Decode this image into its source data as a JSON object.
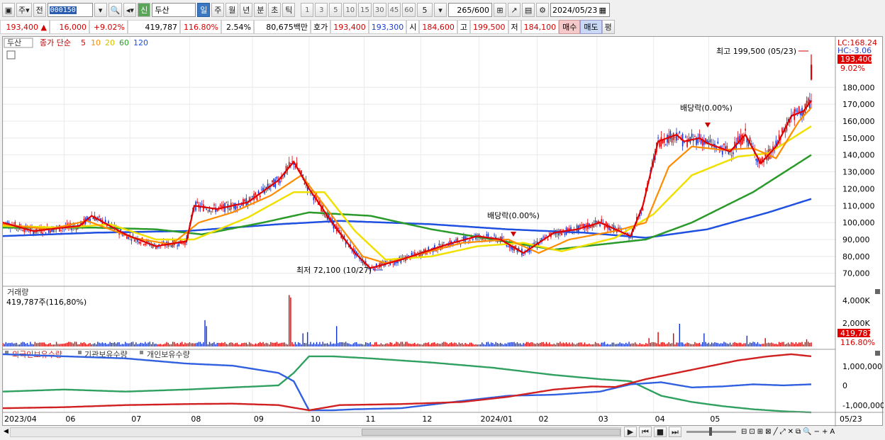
{
  "toolbar": {
    "market_label": "주",
    "prev_label": "전",
    "code": "000150",
    "name_badge": "신",
    "name": "두산",
    "periods": [
      "일",
      "주",
      "월",
      "년",
      "분",
      "초",
      "틱"
    ],
    "minute_steps": [
      "1",
      "3",
      "5",
      "10",
      "15",
      "30",
      "45",
      "60"
    ],
    "step_value": "5",
    "count": "265/600",
    "date": "2024/05/23"
  },
  "infobar": {
    "price": "193,400",
    "change": "16,000",
    "change_pct": "+9.02%",
    "volume": "419,787",
    "volume_ratio": "116.80%",
    "turnover": "2.54%",
    "amount": "80,675백만",
    "quote_label": "호가",
    "ask": "193,400",
    "bid": "193,300",
    "open_label": "시",
    "open": "184,600",
    "high_label": "고",
    "high": "199,500",
    "low_label": "저",
    "low": "184,100",
    "buy": "매수",
    "sell": "매도",
    "eval": "평"
  },
  "chart_data": {
    "type": "line",
    "title": "두산",
    "legend": {
      "stock_name": "두산",
      "ma_prefix": "종가 단순",
      "ma_periods": [
        "5",
        "10",
        "20",
        "60",
        "120"
      ]
    },
    "colors": {
      "ma5": "#e00000",
      "ma10": "#ff8c00",
      "ma20": "#f0e000",
      "ma60": "#2a9a2a",
      "ma120": "#2050e0",
      "up": "#e00000",
      "down": "#1030d0",
      "foreign": "#d02020",
      "inst": "#3060e0",
      "indiv": "#30a060"
    },
    "price_axis": {
      "ticks": [
        70000,
        80000,
        90000,
        100000,
        110000,
        120000,
        130000,
        140000,
        150000,
        160000,
        170000,
        180000
      ],
      "tick_labels": [
        "70,000",
        "80,000",
        "90,000",
        "100,000",
        "110,000",
        "120,000",
        "130,000",
        "140,000",
        "150,000",
        "160,000",
        "170,000",
        "180,000"
      ],
      "range": [
        64000,
        204000
      ]
    },
    "upper_labels": {
      "lc": "LC:168.24",
      "hc": "HC:-3.06",
      "price": "193,400",
      "pct": "9.02%"
    },
    "annotations": {
      "high": "최고 199,500 (05/23)",
      "low": "최저 72,100 (10/27)",
      "div1": "배당락(0.00%)",
      "div2": "배당락(0.00%)"
    },
    "x_axis": {
      "labels": [
        "2023/04",
        "06",
        "07",
        "08",
        "09",
        "10",
        "11",
        "12",
        "2024/01",
        "02",
        "03",
        "04",
        "05",
        "05/23"
      ],
      "label_index": [
        0,
        40,
        83,
        122,
        163,
        200,
        236,
        273,
        311,
        349,
        388,
        425,
        461,
        520
      ]
    },
    "ma_nodes": {
      "ma5": [
        [
          0,
          100000
        ],
        [
          20,
          95000
        ],
        [
          50,
          98000
        ],
        [
          58,
          104000
        ],
        [
          80,
          93000
        ],
        [
          100,
          86000
        ],
        [
          120,
          89000
        ],
        [
          125,
          110000
        ],
        [
          140,
          108000
        ],
        [
          160,
          112000
        ],
        [
          180,
          125000
        ],
        [
          190,
          136000
        ],
        [
          200,
          120000
        ],
        [
          215,
          100000
        ],
        [
          230,
          82000
        ],
        [
          240,
          73000
        ],
        [
          260,
          78000
        ],
        [
          290,
          87000
        ],
        [
          310,
          92000
        ],
        [
          325,
          90000
        ],
        [
          340,
          82000
        ],
        [
          360,
          94000
        ],
        [
          375,
          96000
        ],
        [
          390,
          100000
        ],
        [
          410,
          92000
        ],
        [
          418,
          110000
        ],
        [
          428,
          148000
        ],
        [
          440,
          152000
        ],
        [
          445,
          148000
        ],
        [
          455,
          150000
        ],
        [
          460,
          147000
        ],
        [
          475,
          142000
        ],
        [
          485,
          152000
        ],
        [
          495,
          135000
        ],
        [
          505,
          145000
        ],
        [
          515,
          163000
        ],
        [
          523,
          166000
        ],
        [
          528,
          172000
        ]
      ],
      "ma10": [
        [
          0,
          99000
        ],
        [
          30,
          96000
        ],
        [
          55,
          101000
        ],
        [
          85,
          91000
        ],
        [
          110,
          87000
        ],
        [
          128,
          100000
        ],
        [
          150,
          106000
        ],
        [
          175,
          116000
        ],
        [
          195,
          128000
        ],
        [
          210,
          110000
        ],
        [
          235,
          80000
        ],
        [
          250,
          76000
        ],
        [
          275,
          82000
        ],
        [
          300,
          88000
        ],
        [
          330,
          90000
        ],
        [
          350,
          82000
        ],
        [
          370,
          90000
        ],
        [
          400,
          95000
        ],
        [
          420,
          100000
        ],
        [
          435,
          133000
        ],
        [
          450,
          145000
        ],
        [
          470,
          143000
        ],
        [
          490,
          144000
        ],
        [
          505,
          138000
        ],
        [
          520,
          160000
        ],
        [
          528,
          168000
        ]
      ],
      "ma20": [
        [
          0,
          98000
        ],
        [
          40,
          97000
        ],
        [
          70,
          99000
        ],
        [
          100,
          90000
        ],
        [
          125,
          90000
        ],
        [
          160,
          103000
        ],
        [
          190,
          118000
        ],
        [
          210,
          118000
        ],
        [
          230,
          95000
        ],
        [
          250,
          78000
        ],
        [
          280,
          80000
        ],
        [
          310,
          86000
        ],
        [
          340,
          88000
        ],
        [
          365,
          83000
        ],
        [
          400,
          91000
        ],
        [
          425,
          105000
        ],
        [
          450,
          128000
        ],
        [
          480,
          139000
        ],
        [
          500,
          141000
        ],
        [
          528,
          157000
        ]
      ],
      "ma60": [
        [
          0,
          97000
        ],
        [
          60,
          97000
        ],
        [
          100,
          96000
        ],
        [
          130,
          93000
        ],
        [
          170,
          100000
        ],
        [
          200,
          106000
        ],
        [
          240,
          104000
        ],
        [
          280,
          96000
        ],
        [
          320,
          90000
        ],
        [
          360,
          84000
        ],
        [
          400,
          88000
        ],
        [
          420,
          90000
        ],
        [
          450,
          100000
        ],
        [
          490,
          118000
        ],
        [
          528,
          140000
        ]
      ],
      "ma120": [
        [
          0,
          92000
        ],
        [
          60,
          94000
        ],
        [
          120,
          95000
        ],
        [
          180,
          99000
        ],
        [
          220,
          101000
        ],
        [
          280,
          99000
        ],
        [
          330,
          96000
        ],
        [
          380,
          94000
        ],
        [
          420,
          91000
        ],
        [
          460,
          96000
        ],
        [
          500,
          106000
        ],
        [
          528,
          114000
        ]
      ]
    },
    "volume_panel": {
      "title": "거래량",
      "current": "419,787주(116,80%)",
      "ticks": [
        "4,000K",
        "2,000K"
      ],
      "tick_values": [
        4000,
        2000
      ],
      "range": [
        0,
        4800
      ],
      "last_value": "419,787",
      "last_pct": "116.80%",
      "spikes": [
        [
          132,
          2200
        ],
        [
          133,
          1700
        ],
        [
          187,
          4300
        ],
        [
          188,
          4100
        ],
        [
          196,
          1100
        ],
        [
          199,
          1200
        ],
        [
          218,
          1700
        ],
        [
          422,
          700
        ],
        [
          428,
          1200
        ],
        [
          438,
          1100
        ],
        [
          442,
          1900
        ],
        [
          458,
          1100
        ],
        [
          486,
          900
        ],
        [
          498,
          700
        ],
        [
          525,
          600
        ]
      ]
    },
    "holding_panel": {
      "legend": [
        "외국인보유수량",
        "기관보유수량",
        "개인보유수량"
      ],
      "ticks": [
        "1,000,000",
        "0",
        "-1,000,000"
      ],
      "tick_values": [
        1000000,
        0,
        -1000000
      ],
      "range": [
        -1300000,
        1600000
      ],
      "foreign": [
        [
          0,
          -1100000
        ],
        [
          40,
          -1050000
        ],
        [
          80,
          -950000
        ],
        [
          120,
          -900000
        ],
        [
          150,
          -880000
        ],
        [
          180,
          -950000
        ],
        [
          200,
          -1200000
        ],
        [
          220,
          -950000
        ],
        [
          260,
          -900000
        ],
        [
          300,
          -800000
        ],
        [
          330,
          -550000
        ],
        [
          360,
          -200000
        ],
        [
          385,
          -50000
        ],
        [
          400,
          -80000
        ],
        [
          420,
          300000
        ],
        [
          440,
          600000
        ],
        [
          460,
          900000
        ],
        [
          480,
          1200000
        ],
        [
          500,
          1400000
        ],
        [
          515,
          1500000
        ],
        [
          528,
          1400000
        ]
      ],
      "inst": [
        [
          0,
          1500000
        ],
        [
          40,
          1400000
        ],
        [
          80,
          1300000
        ],
        [
          120,
          1050000
        ],
        [
          150,
          950000
        ],
        [
          180,
          600000
        ],
        [
          190,
          200000
        ],
        [
          200,
          -1200000
        ],
        [
          215,
          -1200000
        ],
        [
          230,
          -1150000
        ],
        [
          260,
          -1100000
        ],
        [
          300,
          -750000
        ],
        [
          330,
          -500000
        ],
        [
          360,
          -450000
        ],
        [
          390,
          -300000
        ],
        [
          410,
          50000
        ],
        [
          430,
          150000
        ],
        [
          450,
          -100000
        ],
        [
          470,
          -50000
        ],
        [
          490,
          50000
        ],
        [
          510,
          0
        ],
        [
          528,
          50000
        ]
      ],
      "indiv": [
        [
          0,
          -300000
        ],
        [
          40,
          -200000
        ],
        [
          80,
          -300000
        ],
        [
          120,
          -200000
        ],
        [
          150,
          -100000
        ],
        [
          180,
          0
        ],
        [
          190,
          600000
        ],
        [
          200,
          1400000
        ],
        [
          215,
          1400000
        ],
        [
          240,
          1300000
        ],
        [
          280,
          1100000
        ],
        [
          320,
          850000
        ],
        [
          360,
          500000
        ],
        [
          390,
          300000
        ],
        [
          410,
          200000
        ],
        [
          430,
          -500000
        ],
        [
          450,
          -800000
        ],
        [
          470,
          -1000000
        ],
        [
          490,
          -1150000
        ],
        [
          510,
          -1250000
        ],
        [
          528,
          -1300000
        ]
      ]
    }
  }
}
